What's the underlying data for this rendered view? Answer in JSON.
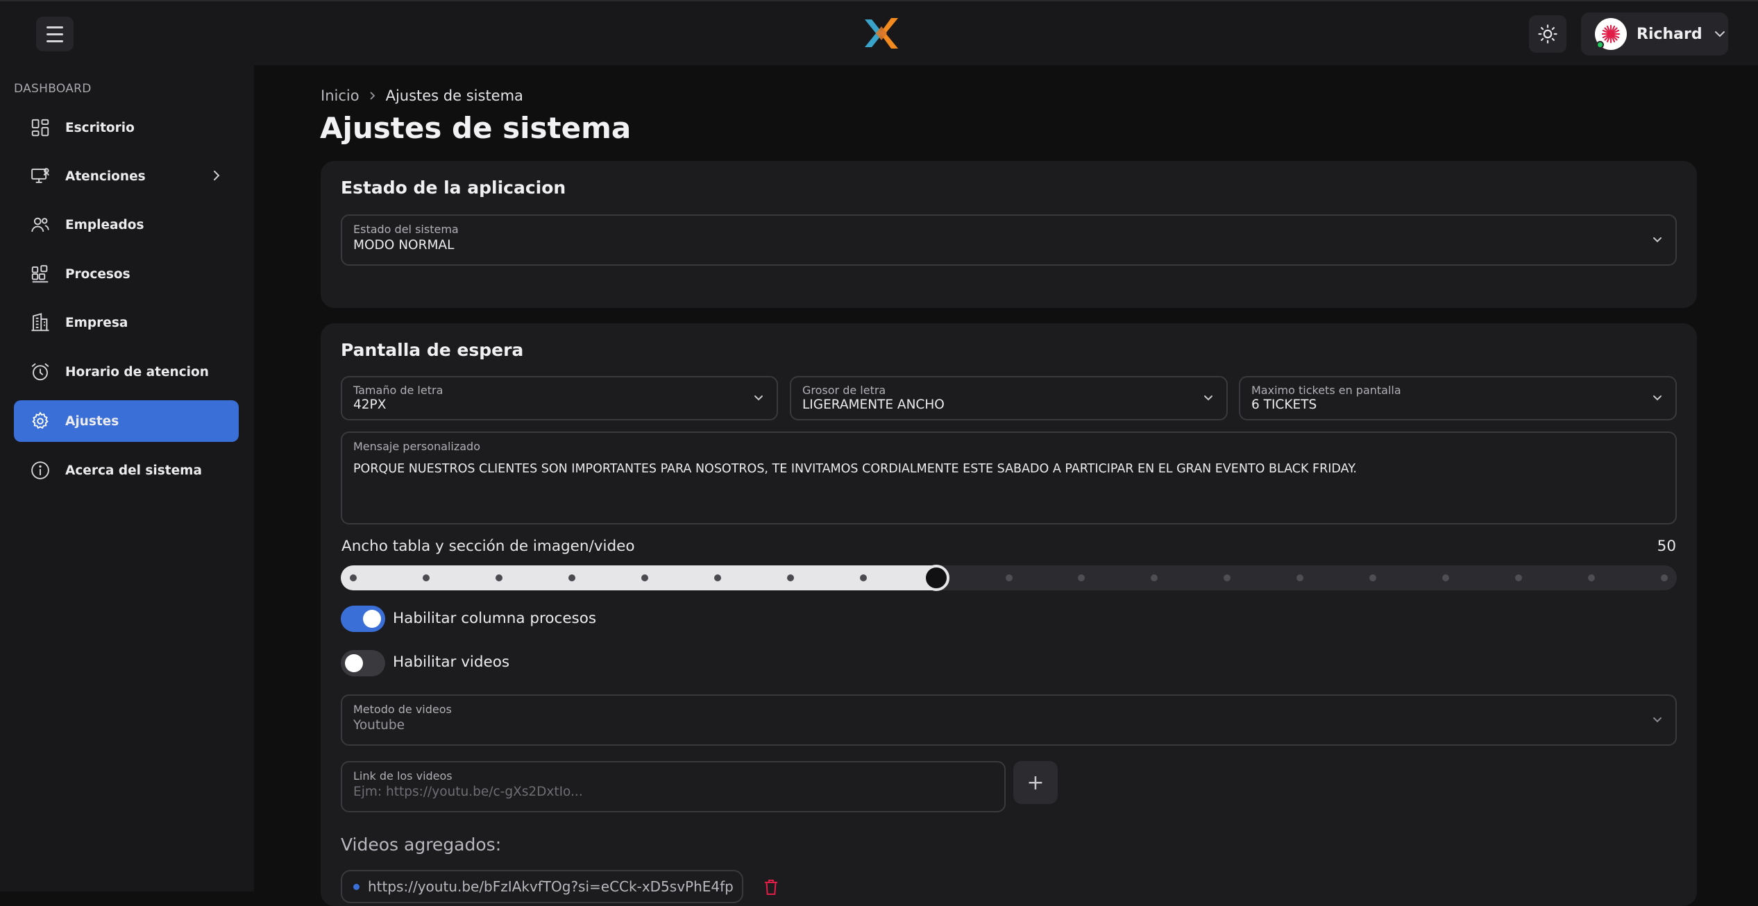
{
  "header": {
    "menu_icon": "hamburger-icon",
    "logo_icon": "app-logo",
    "theme_icon": "sun-icon",
    "user": {
      "name": "Richard",
      "status_color": "#22c55e"
    },
    "colors": {
      "logo_blue": "#3aa3c9",
      "logo_orange": "#f28a1f",
      "avatar_red": "#e11d48"
    }
  },
  "sidebar": {
    "section_label": "DASHBOARD",
    "items": [
      {
        "label": "Escritorio",
        "icon": "dashboard-grid-icon"
      },
      {
        "label": "Atenciones",
        "icon": "monitor-user-icon",
        "has_children": true
      },
      {
        "label": "Empleados",
        "icon": "users-icon"
      },
      {
        "label": "Procesos",
        "icon": "blocks-icon"
      },
      {
        "label": "Empresa",
        "icon": "building-icon"
      },
      {
        "label": "Horario de atencion",
        "icon": "alarm-clock-icon"
      },
      {
        "label": "Ajustes",
        "icon": "gear-icon",
        "active": true
      },
      {
        "label": "Acerca del sistema",
        "icon": "info-icon"
      }
    ],
    "accent_color": "#3b6fd8"
  },
  "breadcrumb": {
    "home": "Inicio",
    "current": "Ajustes de sistema"
  },
  "page_title": "Ajustes de sistema",
  "app_state": {
    "title": "Estado de la aplicacion",
    "estado": {
      "label": "Estado del sistema",
      "value": "MODO NORMAL"
    }
  },
  "waiting_screen": {
    "title": "Pantalla de espera",
    "font_size": {
      "label": "Tamaño de letra",
      "value": "42PX"
    },
    "font_weight": {
      "label": "Grosor de letra",
      "value": "LIGERAMENTE ANCHO"
    },
    "max_tickets": {
      "label": "Maximo tickets en pantalla",
      "value": "6 TICKETS"
    },
    "message": {
      "label": "Mensaje personalizado",
      "value": "PORQUE NUESTROS CLIENTES SON IMPORTANTES PARA NOSOTROS, TE INVITAMOS CORDIALMENTE ESTE SABADO A PARTICIPAR EN EL GRAN EVENTO BLACK FRIDAY."
    },
    "width_slider": {
      "label": "Ancho tabla y sección de imagen/video",
      "value_text": "50",
      "min": 10,
      "max": 100,
      "step": 5,
      "value": 50
    },
    "toggle_processes": {
      "label": "Habilitar columna procesos",
      "on": true
    },
    "toggle_videos": {
      "label": "Habilitar videos",
      "on": false
    },
    "video_method": {
      "label": "Metodo de videos",
      "value": "Youtube"
    },
    "video_link": {
      "label": "Link de los videos",
      "placeholder": "Ejm: https://youtu.be/c-gXs2DxtIo..."
    },
    "add_icon": "plus-icon",
    "videos_title": "Videos agregados:",
    "videos": [
      {
        "url": "https://youtu.be/bFzIAkvfTOg?si=eCCk-xD5svPhE4fp"
      }
    ],
    "delete_icon": "trash-icon",
    "delete_color": "#e11d48"
  }
}
